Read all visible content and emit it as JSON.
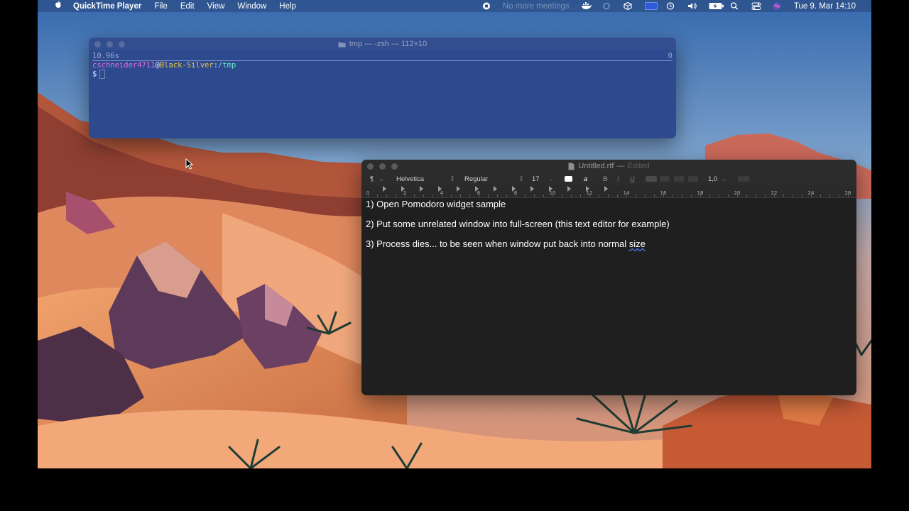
{
  "menubar": {
    "apple_icon": "apple-logo-icon",
    "app_name": "QuickTime Player",
    "menus": [
      "File",
      "Edit",
      "View",
      "Window",
      "Help"
    ],
    "meetings_text": "No more meetings",
    "datetime": "Tue 9. Mar  14:10"
  },
  "terminal": {
    "title": "tmp — -zsh — 112×10",
    "status_left": "10.96s",
    "status_right": "0",
    "user": "cschneider4711",
    "at": "@",
    "host": "Black-Silver",
    "colon": ":",
    "path": "/tmp",
    "prompt": "$"
  },
  "textedit": {
    "title": "Untitled.rtf",
    "title_sep": "—",
    "edited": "Edited",
    "toolbar": {
      "paragraph_symbol": "¶",
      "font": "Helvetica",
      "style": "Regular",
      "size": "17",
      "line_spacing": "1,0"
    },
    "ruler": [
      "0",
      "2",
      "4",
      "6",
      "8",
      "10",
      "12",
      "14",
      "16",
      "18",
      "20",
      "22",
      "24",
      "26"
    ],
    "lines": [
      "1) Open Pomodoro widget sample",
      "2) Put some unrelated window into full-screen (this text editor for example)",
      "3) Process dies... to be seen when window put back into normal "
    ],
    "misspelled_word": "size"
  },
  "colors": {
    "terminal_bg": "#2d4a8f",
    "editor_bg": "#1f1f1f",
    "user_color": "#e26de0",
    "host_color": "#e7c64a",
    "path_color": "#6fe0c6"
  }
}
